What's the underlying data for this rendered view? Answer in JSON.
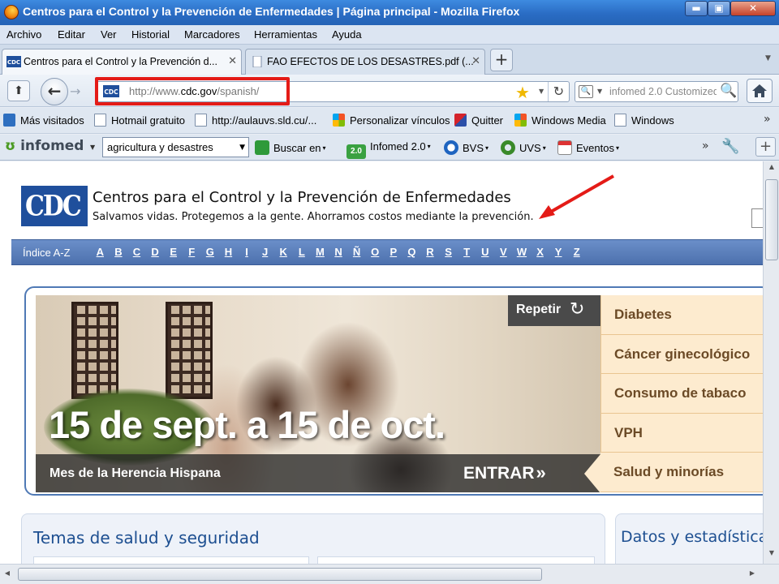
{
  "window": {
    "title": "Centros para el Control y la Prevención de Enfermedades | Página principal - Mozilla Firefox",
    "controls": {
      "minimize": "▬",
      "maximize": "▣",
      "close": "✕"
    }
  },
  "menu": [
    "Archivo",
    "Editar",
    "Ver",
    "Historial",
    "Marcadores",
    "Herramientas",
    "Ayuda"
  ],
  "tabs": [
    {
      "label": "Centros para el Control y la Prevención d...",
      "icon": "cdc-favicon",
      "active": true
    },
    {
      "label": "FAO EFECTOS DE LOS DESASTRES.pdf (...",
      "icon": "page-icon",
      "active": false
    }
  ],
  "tab_controls": {
    "close": "✕",
    "new_tab": "+",
    "list": "▼"
  },
  "nav": {
    "url_prefix": "http://www.",
    "url_host": "cdc.gov",
    "url_path": "/spanish/",
    "search_placeholder": "infomed 2.0 Customized",
    "glyphs": {
      "back": "←",
      "forward": "→",
      "star": "★",
      "reload": "↻",
      "dropdown": "▼",
      "search": "🔍",
      "search_engine": "🔍",
      "home_small": "⬆"
    },
    "highlight_color": "#e41b17"
  },
  "bookmarks": {
    "items": [
      {
        "label": "Más visitados",
        "icon": "most-visited-icon"
      },
      {
        "label": "Hotmail gratuito",
        "icon": "page-icon"
      },
      {
        "label": "http://aulauvs.sld.cu/...",
        "icon": "page-icon"
      },
      {
        "label": "Personalizar vínculos",
        "icon": "windows-logo-icon"
      },
      {
        "label": "Quitter",
        "icon": "quitter-icon"
      },
      {
        "label": "Windows Media",
        "icon": "windows-logo-icon"
      },
      {
        "label": "Windows",
        "icon": "page-icon"
      }
    ],
    "overflow": "»"
  },
  "infomed_toolbar": {
    "logo_mark": "ʊ",
    "logo": "infomed",
    "combo_value": "agricultura y desastres",
    "buscar": "Buscar en",
    "infomed20_badge": "2.0",
    "infomed20": "Infomed 2.0",
    "bvs": "BVS",
    "uvs": "UVS",
    "eventos": "Eventos",
    "caret": "▾",
    "overflow": "»",
    "wrench": "🔧",
    "plus": "+"
  },
  "page": {
    "logo_text": "CDC",
    "title": "Centros para el Control y la Prevención de Enfermedades",
    "tagline": "Salvamos vidas. Protegemos a la gente. Ahorramos costos mediante la prevención.",
    "az_label": "Índice A-Z",
    "az_letters": [
      "A",
      "B",
      "C",
      "D",
      "E",
      "F",
      "G",
      "H",
      "I",
      "J",
      "K",
      "L",
      "M",
      "N",
      "Ñ",
      "O",
      "P",
      "Q",
      "R",
      "S",
      "T",
      "U",
      "V",
      "W",
      "X",
      "Y",
      "Z"
    ],
    "hero": {
      "date_text": "15 de sept. a 15 de oct.",
      "caption": "Mes de la Herencia Hispana",
      "enter": "ENTRAR",
      "enter_arrows": "»",
      "repeat": "Repetir",
      "repeat_icon": "↻"
    },
    "topics": [
      "Diabetes",
      "Cáncer ginecológico",
      "Consumo de tabaco",
      "VPH",
      "Salud y minorías"
    ],
    "selected_topic_index": 4,
    "temas_title": "Temas de salud y seguridad",
    "datos_title": "Datos y estadísticas"
  },
  "scrollbars": {
    "up": "▲",
    "down": "▼",
    "left": "◀",
    "right": "▶"
  },
  "colors": {
    "titlebar": "#2a6cc4",
    "cdc_blue": "#1f4f9c",
    "az_bar": "#4c70ad",
    "topic_bg": "#fdebcf",
    "topic_text": "#6b4a26",
    "annotation_red": "#e41b17"
  }
}
